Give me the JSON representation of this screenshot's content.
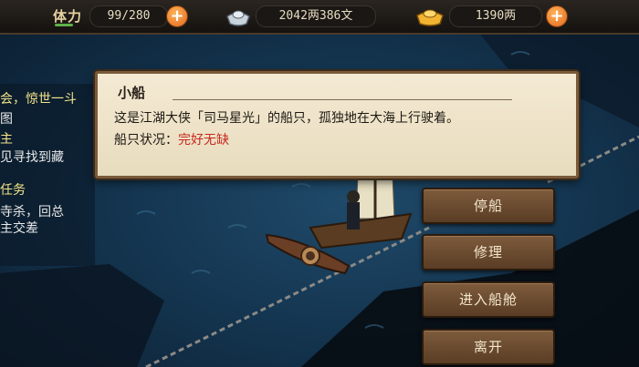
{
  "top_bar": {
    "stamina_label": "体力",
    "stamina_value": "99/280",
    "silver_value": "2042两386文",
    "gold_value": "1390两",
    "add_label": "+",
    "icons": [
      "silver-ingot-icon",
      "gold-ingot-icon",
      "plus-icon"
    ]
  },
  "quests": [
    {
      "text": "会，惊世一斗",
      "color": "#f2e48a"
    },
    {
      "text": "图",
      "color": "#e8e8e8"
    },
    {
      "text": "主",
      "color": "#f2e48a"
    },
    {
      "text": "见寻找到藏",
      "color": "#e8e8e8"
    },
    {
      "text": "任务",
      "color": "#f2e48a"
    },
    {
      "text": "寺杀，回总",
      "color": "#e8e8e8"
    },
    {
      "text": "主交差",
      "color": "#e8e8e8"
    }
  ],
  "dialog": {
    "title": "小船",
    "description": "这是江湖大侠「司马星光」的船只，孤独地在大海上行驶着。",
    "status_label": "船只状况：",
    "status_value": "完好无缺"
  },
  "actions": {
    "stop": "停船",
    "repair": "修理",
    "enter_cabin": "进入船舱",
    "leave": "离开"
  },
  "colors": {
    "sea": "#143550",
    "panel": "#f4ead3",
    "button": "#6b4a2e",
    "status_red": "#c8281e",
    "quest_yellow": "#f2e48a"
  }
}
